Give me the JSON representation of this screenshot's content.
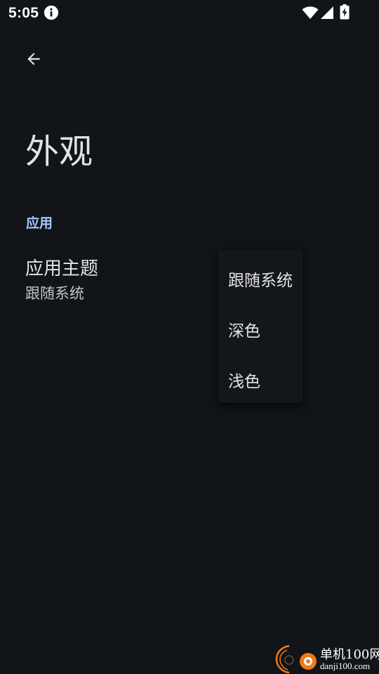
{
  "status_bar": {
    "time": "5:05",
    "icons": [
      "info-icon",
      "wifi-icon",
      "cellular-signal-icon",
      "battery-charging-icon"
    ]
  },
  "toolbar": {
    "back_icon": "arrow-back-icon"
  },
  "page": {
    "title": "外观"
  },
  "sections": [
    {
      "header": "应用",
      "items": [
        {
          "title": "应用主题",
          "summary": "跟随系统"
        }
      ]
    }
  ],
  "popup_menu": {
    "items": [
      {
        "label": "跟随系统"
      },
      {
        "label": "深色"
      },
      {
        "label": "浅色"
      }
    ]
  },
  "watermark": {
    "name": "单机100网",
    "url": "danji100.com"
  },
  "colors": {
    "background": "#111418",
    "accent": "#a6c8ff",
    "text_primary": "#e3e3e6",
    "text_secondary": "#c2c4c9",
    "menu_background": "#141719",
    "watermark_orange": "#f07a1a"
  }
}
